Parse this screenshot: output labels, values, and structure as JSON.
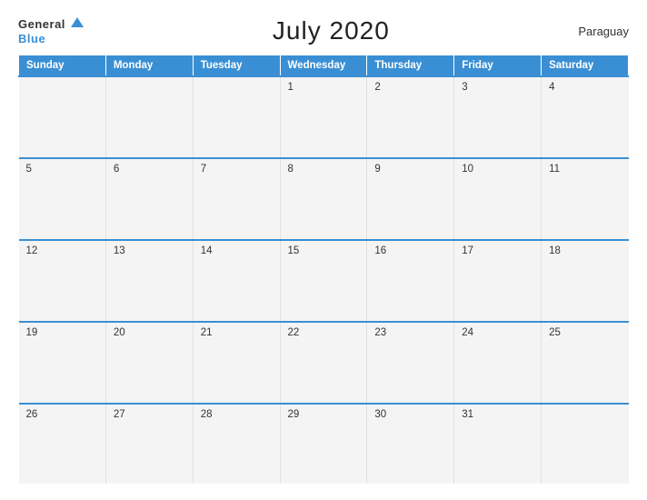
{
  "header": {
    "logo_general": "General",
    "logo_blue": "Blue",
    "title": "July 2020",
    "country": "Paraguay"
  },
  "calendar": {
    "days": [
      "Sunday",
      "Monday",
      "Tuesday",
      "Wednesday",
      "Thursday",
      "Friday",
      "Saturday"
    ],
    "weeks": [
      [
        null,
        null,
        null,
        1,
        2,
        3,
        4
      ],
      [
        5,
        6,
        7,
        8,
        9,
        10,
        11
      ],
      [
        12,
        13,
        14,
        15,
        16,
        17,
        18
      ],
      [
        19,
        20,
        21,
        22,
        23,
        24,
        25
      ],
      [
        26,
        27,
        28,
        29,
        30,
        31,
        null
      ]
    ]
  }
}
